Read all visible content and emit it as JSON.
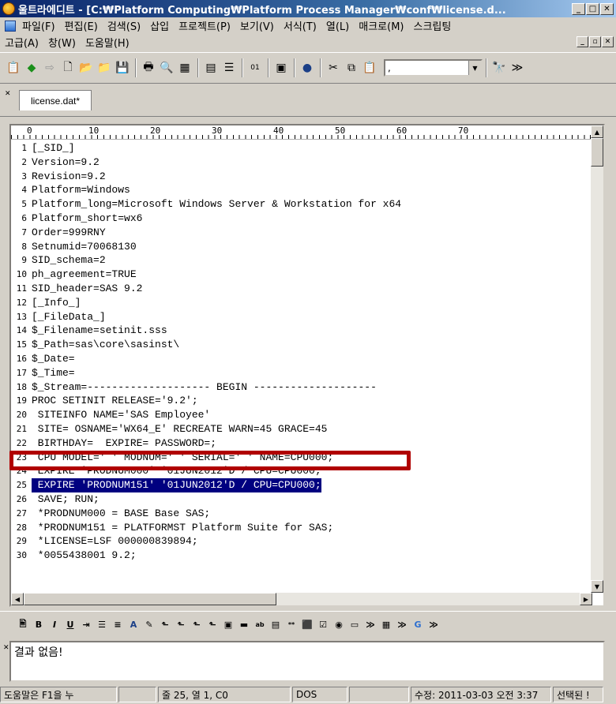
{
  "window": {
    "title": "울트라에디트 - [C:₩Platform Computing₩Platform Process Manager₩conf₩license.d..."
  },
  "menu": {
    "row1": [
      "파일(F)",
      "편집(E)",
      "검색(S)",
      "삽입",
      "프로젝트(P)",
      "보기(V)",
      "서식(T)",
      "열(L)",
      "매크로(M)",
      "스크립팅"
    ],
    "row2": [
      "고급(A)",
      "창(W)",
      "도움말(H)"
    ]
  },
  "toolbar": {
    "combo_value": ","
  },
  "tabs": [
    {
      "label": "license.dat*"
    }
  ],
  "ruler": {
    "marks": [
      "0",
      "10",
      "20",
      "30",
      "40",
      "50",
      "60",
      "70"
    ]
  },
  "editor": {
    "lines": [
      {
        "n": "1",
        "t": "[_SID_]"
      },
      {
        "n": "2",
        "t": "Version=9.2"
      },
      {
        "n": "3",
        "t": "Revision=9.2"
      },
      {
        "n": "4",
        "t": "Platform=Windows"
      },
      {
        "n": "5",
        "t": "Platform_long=Microsoft Windows Server & Workstation for x64"
      },
      {
        "n": "6",
        "t": "Platform_short=wx6"
      },
      {
        "n": "7",
        "t": "Order=999RNY"
      },
      {
        "n": "8",
        "t": "Setnumid=70068130"
      },
      {
        "n": "9",
        "t": "SID_schema=2"
      },
      {
        "n": "10",
        "t": "ph_agreement=TRUE"
      },
      {
        "n": "11",
        "t": "SID_header=SAS 9.2"
      },
      {
        "n": "12",
        "t": "[_Info_]"
      },
      {
        "n": "13",
        "t": "[_FileData_]"
      },
      {
        "n": "14",
        "t": "$_Filename=setinit.sss"
      },
      {
        "n": "15",
        "t": "$_Path=sas\\core\\sasinst\\"
      },
      {
        "n": "16",
        "t": "$_Date="
      },
      {
        "n": "17",
        "t": "$_Time="
      },
      {
        "n": "18",
        "t": "$_Stream=-------------------- BEGIN --------------------"
      },
      {
        "n": "19",
        "t": "PROC SETINIT RELEASE='9.2';"
      },
      {
        "n": "20",
        "t": " SITEINFO NAME='SAS Employee'"
      },
      {
        "n": "21",
        "t": " SITE= OSNAME='WX64_E' RECREATE WARN=45 GRACE=45"
      },
      {
        "n": "22",
        "t": " BIRTHDAY=  EXPIRE= PASSWORD=;"
      },
      {
        "n": "23",
        "t": " CPU MODEL=' ' MODNUM=' ' SERIAL=' ' NAME=CPU000;"
      },
      {
        "n": "24",
        "t": " EXPIRE 'PRODNUM000' '01JUN2012'D / CPU=CPU000;"
      },
      {
        "n": "25",
        "t": " EXPIRE 'PRODNUM151' '01JUN2012'D / CPU=CPU000;"
      },
      {
        "n": "26",
        "t": " SAVE; RUN;"
      },
      {
        "n": "27",
        "t": " *PRODNUM000 = BASE Base SAS;"
      },
      {
        "n": "28",
        "t": " *PRODNUM151 = PLATFORMST Platform Suite for SAS;"
      },
      {
        "n": "29",
        "t": " *LICENSE=LSF 000000839894;"
      },
      {
        "n": "30",
        "t": " *0055438001 9.2;"
      }
    ],
    "selected_line": "25"
  },
  "output": {
    "text": "결과 없음!"
  },
  "status": {
    "help": "도움말은 F1을 누",
    "position": "줄 25, 열 1, C0",
    "format": "DOS",
    "modified": "수정: 2011-03-03 오전 3:37",
    "selection": "선택된 !"
  }
}
